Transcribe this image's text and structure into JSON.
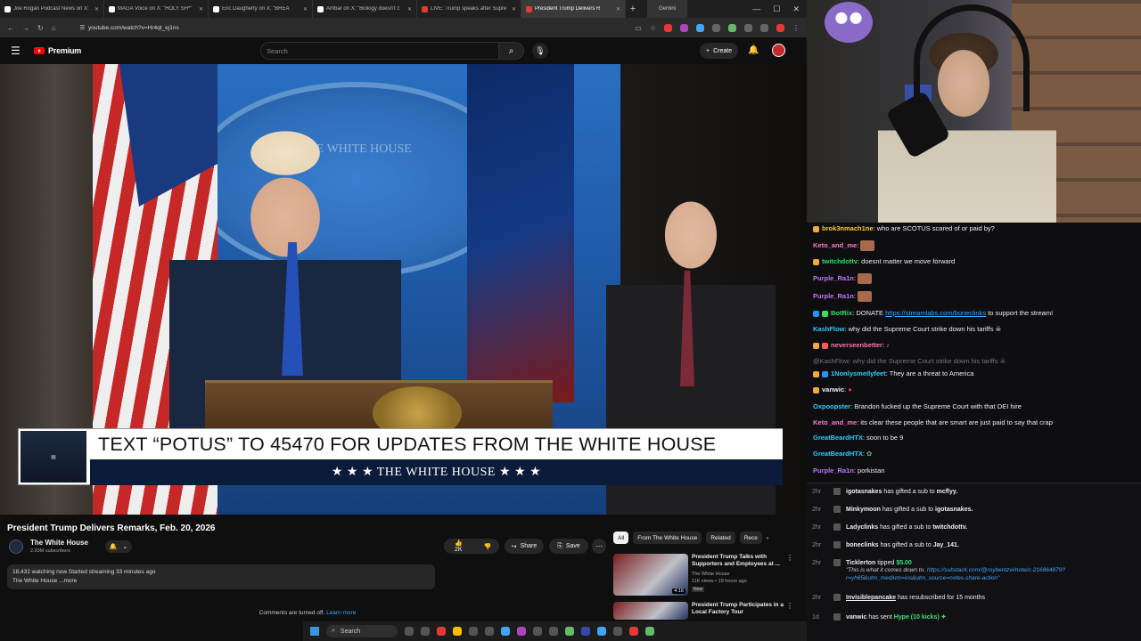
{
  "browser": {
    "tabs": [
      {
        "title": "Joe Rogan Podcast News on X:",
        "icon": "x-icon"
      },
      {
        "title": "MAGA Voice on X: \"HOLY SH*\"",
        "icon": "x-icon"
      },
      {
        "title": "Eric Daugherty on X: \"BREA",
        "icon": "x-icon"
      },
      {
        "title": "Ambar on X: \"Biology doesn't c",
        "icon": "x-icon"
      },
      {
        "title": "LIVE: Trump speaks after Supre",
        "icon": "youtube-icon"
      },
      {
        "title": "President Trump Delivers R",
        "icon": "youtube-icon"
      }
    ],
    "gemini_tab": "Gemini",
    "url": "youtube.com/watch?v=Hr4qt_ej1ns"
  },
  "youtube": {
    "logo_text": "Premium",
    "search_placeholder": "Search",
    "create_label": "Create",
    "lower_third_text": "TEXT “POTUS” TO 45470 FOR UPDATES FROM THE WHITE HOUSE",
    "lower_third_sub": "★ ★ ★  THE WHITE HOUSE  ★ ★ ★",
    "video_title": "President Trump Delivers Remarks, Feb. 20, 2026",
    "channel_name": "The White House",
    "channel_subs": "2.93M subscribers",
    "likes": "2K",
    "share_label": "Share",
    "save_label": "Save",
    "description_line1": "18,432 watching now  Started streaming 33 minutes ago",
    "description_line2": "The White House ...more",
    "comments_off": "Comments are turned off.",
    "learn_more": "Learn more",
    "chips": [
      "All",
      "From The White House",
      "Related",
      "Rece"
    ],
    "recommendations": [
      {
        "title": "President Trump Talks with Supporters and Employees at ...",
        "channel": "The White House",
        "views": "11K views • 19 hours ago",
        "badge": "New",
        "duration": "4:16"
      },
      {
        "title": "President Trump Participates in a Local Factory Tour",
        "channel": "",
        "views": "",
        "badge": "",
        "duration": ""
      }
    ]
  },
  "taskbar": {
    "search_label": "Search"
  },
  "chat": {
    "messages": [
      {
        "user": "brok3nmach1ne",
        "color": "#ffcc33",
        "text": "who are SCOTUS scared of or paid by?",
        "emote": false
      },
      {
        "user": "Keto_and_me",
        "color": "#ff7acb",
        "text": "",
        "emote": true
      },
      {
        "user": "twitchdottv",
        "color": "#33dd66",
        "text": "doesnt matter we move forward",
        "emote": false
      },
      {
        "user": "Purple_Ra1n",
        "color": "#c176ff",
        "text": "",
        "emote": true
      },
      {
        "user": "Purple_Ra1n",
        "color": "#c176ff",
        "text": "",
        "emote": true
      },
      {
        "user": "BotRix",
        "color": "#33dd66",
        "text": "DONATE",
        "link": "https://streamlabs.com/boneclinks",
        "after": "to support the stream!",
        "emote": false
      },
      {
        "user": "KashFlow",
        "color": "#33ccff",
        "text": "why did the Supreme Court strike down his tariffs ☠",
        "emote": false
      },
      {
        "user": "neverseenbetter",
        "color": "#ff77aa",
        "text": "",
        "emote": false
      },
      {
        "user": "@KashFlow:",
        "color": "#777777",
        "text": "why did the Supreme Court strike down his tariffs ☠",
        "emote": false
      },
      {
        "user": "1NonlysmeIlyfeet",
        "color": "#33ccff",
        "text": "They are a threat to America",
        "emote": false
      },
      {
        "user": "vanwic",
        "color": "#efeff1",
        "text": "",
        "emote": false
      },
      {
        "user": "Oxpoopster",
        "color": "#33ccff",
        "text": "Brandon fucked up the Supreme Court with that DEI hire",
        "emote": false
      },
      {
        "user": "Keto_and_me",
        "color": "#ff7acb",
        "text": "its clear these people that are smart are just paid to say that crap",
        "emote": false
      },
      {
        "user": "GreatBeardHTX",
        "color": "#33ccff",
        "text": "soon to be 9",
        "emote": false
      },
      {
        "user": "GreatBeardHTX",
        "color": "#33ccff",
        "text": "",
        "emote": false
      },
      {
        "user": "Purple_Ra1n",
        "color": "#c176ff",
        "text": "porkistan",
        "emote": false
      }
    ],
    "events": [
      {
        "time": "2hr",
        "user": "igotasnakes",
        "text": "has gifted a sub to",
        "target": "mcflyy."
      },
      {
        "time": "2hr",
        "user": "Minkymoon",
        "text": "has gifted a sub to",
        "target": "igotasnakes."
      },
      {
        "time": "2hr",
        "user": "Ladyclinks",
        "text": "has gifted a sub to",
        "target": "twitchdottv."
      },
      {
        "time": "2hr",
        "user": "boneclinks",
        "text": "has gifted a sub to",
        "target": "Jay_141."
      }
    ],
    "tip": {
      "time": "2hr",
      "user": "Ticklerton",
      "text": "tipped",
      "amount": "$5.00",
      "quote": "\"This is what it comes down to.",
      "link": "https://substack.com/@roybentzvi/note/c-216864879?r=yh65&utm_medium=ios&utm_source=notes-share-action\""
    },
    "resub": {
      "time": "2hr",
      "user": "Invisiblepancake",
      "text": "has resubscribed for 15 months"
    },
    "hype": {
      "time": "1d",
      "user": "vanwic",
      "text": "has sent",
      "amount": "Hype (10 kicks)"
    }
  }
}
